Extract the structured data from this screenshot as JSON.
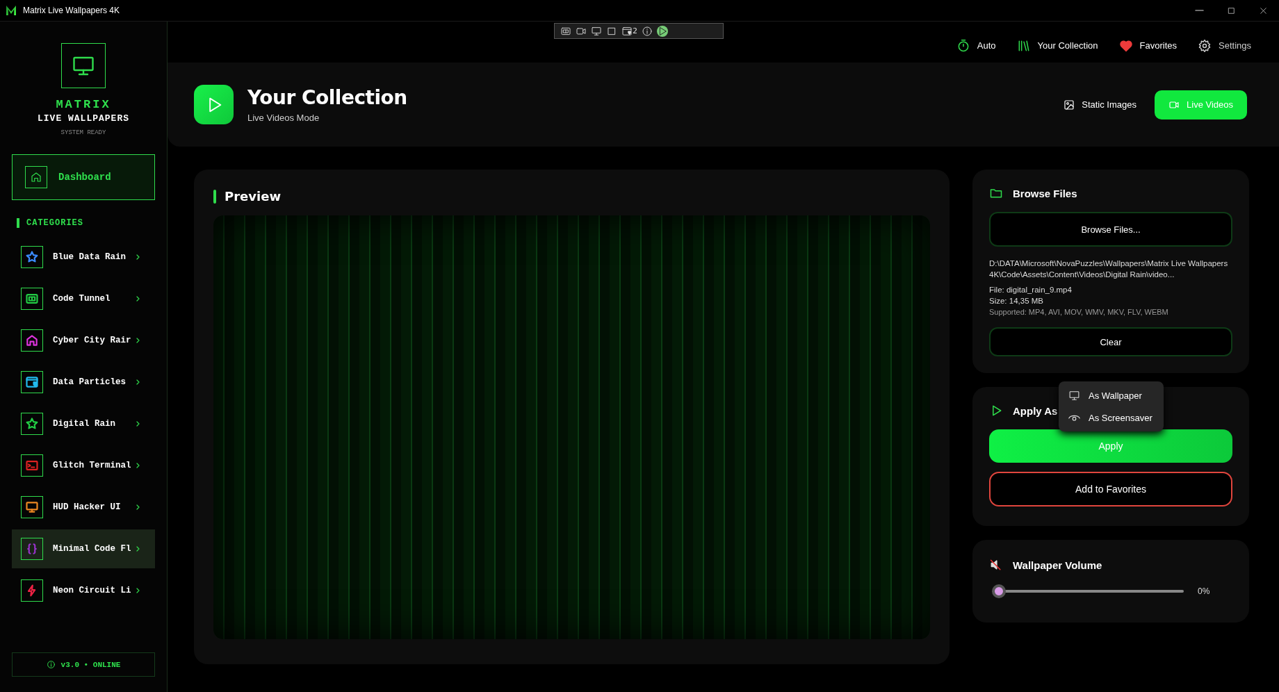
{
  "window": {
    "title": "Matrix Live Wallpapers 4K"
  },
  "debug_toolbar": {
    "count": "2"
  },
  "nav": [
    {
      "label": "Auto",
      "kind": "timer"
    },
    {
      "label": "Your Collection",
      "kind": "library"
    },
    {
      "label": "Favorites",
      "kind": "heart"
    },
    {
      "label": "Settings",
      "kind": "gear"
    }
  ],
  "sidebar": {
    "logo": {
      "title": "MATRIX",
      "subtitle": "LIVE WALLPAPERS",
      "status": "SYSTEM READY"
    },
    "dashboard": "Dashboard",
    "section": "CATEGORIES",
    "items": [
      {
        "label": "Blue Data Rain",
        "kind": "star",
        "color": "#3b8bff",
        "selected": false
      },
      {
        "label": "Code Tunnel",
        "kind": "grid",
        "color": "#22cc44",
        "selected": false
      },
      {
        "label": "Cyber City Rair",
        "kind": "house",
        "color": "#dd33dd",
        "selected": false
      },
      {
        "label": "Data Particles",
        "kind": "card",
        "color": "#22bbee",
        "selected": false
      },
      {
        "label": "Digital Rain",
        "kind": "star",
        "color": "#22cc44",
        "selected": false
      },
      {
        "label": "Glitch Terminal",
        "kind": "terminal",
        "color": "#dd2222",
        "selected": false
      },
      {
        "label": "HUD Hacker UI",
        "kind": "monitor",
        "color": "#ee8822",
        "selected": false
      },
      {
        "label": "Minimal Code Fl",
        "kind": "braces",
        "color": "#9933cc",
        "selected": true
      },
      {
        "label": "Neon Circuit Li",
        "kind": "bolt",
        "color": "#ee2244",
        "selected": false
      }
    ],
    "footer": "v3.0 • ONLINE"
  },
  "header": {
    "title": "Your Collection",
    "subtitle": "Live Videos Mode",
    "modes": [
      {
        "label": "Static Images",
        "kind": "image",
        "selected": false
      },
      {
        "label": "Live Videos",
        "kind": "video",
        "selected": true
      }
    ]
  },
  "preview": {
    "title": "Preview"
  },
  "browse": {
    "title": "Browse Files",
    "button": "Browse Files...",
    "path": "D:\\DATA\\Microsoft\\NovaPuzzles\\Wallpapers\\Matrix Live Wallpapers 4K\\Code\\Assets\\Content\\Videos\\Digital Rain\\video...",
    "file": "File: digital_rain_9.mp4",
    "size": "Size: 14,35 MB",
    "supported": "Supported: MP4, AVI, MOV, WMV, MKV, FLV, WEBM",
    "clear": "Clear"
  },
  "apply": {
    "title": "Apply As",
    "menu": [
      {
        "label": "As Wallpaper",
        "kind": "monitor"
      },
      {
        "label": "As Screensaver",
        "kind": "eye"
      }
    ],
    "apply": "Apply",
    "favorite": "Add to Favorites"
  },
  "volume": {
    "title": "Wallpaper Volume",
    "level": 0,
    "reading": "0%"
  }
}
